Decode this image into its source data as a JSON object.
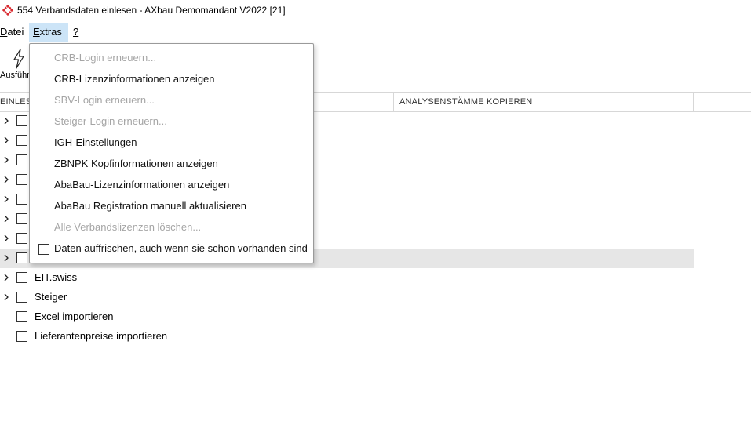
{
  "window": {
    "title": "554 Verbandsdaten einlesen - AXbau Demomandant V2022 [21]"
  },
  "menubar": {
    "items": [
      {
        "label": "Datei",
        "mnemonic": "D",
        "rest": "atei"
      },
      {
        "label": "Extras",
        "mnemonic": "E",
        "rest": "xtras"
      },
      {
        "label": "?",
        "mnemonic": "?",
        "rest": ""
      }
    ]
  },
  "toolbar": {
    "run_label": "Ausführ"
  },
  "grid": {
    "col1": "EINLES",
    "col2": "ANALYSENSTÄMME KOPIEREN"
  },
  "tree": {
    "rows": [
      {
        "label": "",
        "expandable": true,
        "checked": false
      },
      {
        "label": "",
        "expandable": true,
        "checked": false
      },
      {
        "label": "",
        "expandable": true,
        "checked": false
      },
      {
        "label": "",
        "expandable": true,
        "checked": false
      },
      {
        "label": "",
        "expandable": true,
        "checked": false
      },
      {
        "label": "",
        "expandable": true,
        "checked": false
      },
      {
        "label": "",
        "expandable": true,
        "checked": false
      },
      {
        "label": "",
        "expandable": true,
        "checked": false,
        "selected": true
      },
      {
        "label": "EIT.swiss",
        "expandable": true,
        "checked": false
      },
      {
        "label": "Steiger",
        "expandable": true,
        "checked": false
      },
      {
        "label": "Excel importieren",
        "expandable": false,
        "checked": false
      },
      {
        "label": "Lieferantenpreise importieren",
        "expandable": false,
        "checked": false
      }
    ]
  },
  "extras_menu": {
    "items": [
      {
        "label": "CRB-Login erneuern...",
        "disabled": true
      },
      {
        "label": "CRB-Lizenzinformationen anzeigen",
        "disabled": false
      },
      {
        "label": "SBV-Login erneuern...",
        "disabled": true
      },
      {
        "label": "Steiger-Login erneuern...",
        "disabled": true
      },
      {
        "label": "IGH-Einstellungen",
        "disabled": false
      },
      {
        "label": "ZBNPK Kopfinformationen anzeigen",
        "disabled": false
      },
      {
        "label": "AbaBau-Lizenzinformationen anzeigen",
        "disabled": false
      },
      {
        "label": "AbaBau Registration manuell aktualisieren",
        "disabled": false
      },
      {
        "label": "Alle Verbandslizenzen löschen...",
        "disabled": true
      },
      {
        "label": "Daten auffrischen, auch wenn sie schon vorhanden sind",
        "disabled": false,
        "checkbox": true,
        "checked": false
      }
    ]
  },
  "colors": {
    "menu_active": "#cce4f7",
    "selected_row": "#e6e6e6",
    "disabled_text": "#a5a5a5",
    "app_icon": "#d9292f"
  }
}
